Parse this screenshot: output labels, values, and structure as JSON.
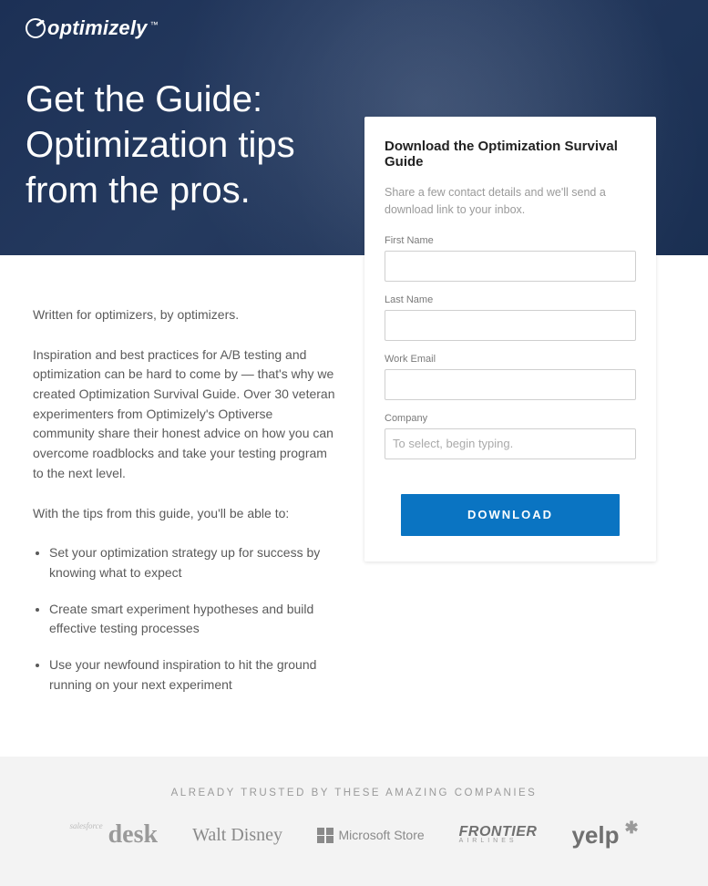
{
  "brand": {
    "name": "optimizely",
    "tm": "™"
  },
  "hero": {
    "heading": "Get the Guide: Optimization tips from the pros."
  },
  "left": {
    "intro": "Written for optimizers, by optimizers.",
    "body": "Inspiration and best practices for A/B testing and optimization can be hard to come by — that's why we created Optimization Survival Guide. Over 30 veteran experimenters from Optimizely's Optiverse community share their honest advice on how you can overcome roadblocks and take your testing program to the next level.",
    "lead_in": "With the tips from this guide, you'll be able to:",
    "bullets": [
      "Set your optimization strategy up for success by knowing what to expect",
      "Create smart experiment hypotheses and build effective testing processes",
      "Use your newfound inspiration to hit the ground running on your next experiment"
    ]
  },
  "form": {
    "title": "Download the Optimization Survival Guide",
    "subtitle": "Share a few contact details and we'll send a download link to your inbox.",
    "fields": {
      "first_name": {
        "label": "First Name",
        "value": ""
      },
      "last_name": {
        "label": "Last Name",
        "value": ""
      },
      "work_email": {
        "label": "Work Email",
        "value": ""
      },
      "company": {
        "label": "Company",
        "value": "",
        "placeholder": "To select, begin typing."
      }
    },
    "submit_label": "DOWNLOAD"
  },
  "trusted": {
    "heading": "ALREADY TRUSTED BY THESE AMAZING COMPANIES",
    "logos": {
      "desk": {
        "tag": "salesforce",
        "text": "desk"
      },
      "disney": "Walt Disney",
      "microsoft": "Microsoft Store",
      "frontier": {
        "text": "FRONTIER",
        "sub": "AIRLINES"
      },
      "yelp": "yelp"
    }
  }
}
